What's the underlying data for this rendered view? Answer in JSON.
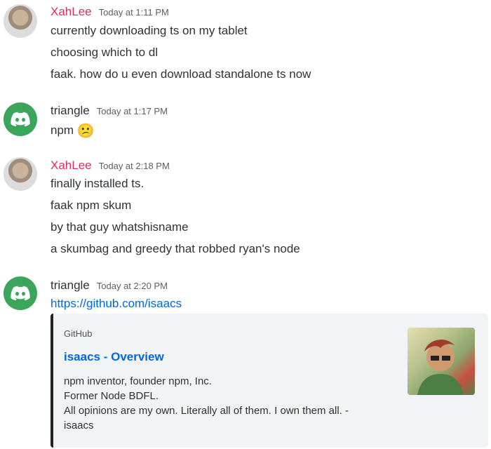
{
  "messages": [
    {
      "username": "XahLee",
      "username_color": "#d92f5a",
      "timestamp": "Today at 1:11 PM",
      "avatar": "user-photo-avatar",
      "lines": [
        "currently downloading ts on my tablet",
        "choosing which to dl",
        "faak. how do u even download standalone ts now"
      ]
    },
    {
      "username": "triangle",
      "username_color": "#2e3338",
      "timestamp": "Today at 1:17 PM",
      "avatar": "discord-logo-avatar",
      "lines": [
        "npm"
      ],
      "emoji": "😕"
    },
    {
      "username": "XahLee",
      "username_color": "#d92f5a",
      "timestamp": "Today at 2:18 PM",
      "avatar": "user-photo-avatar",
      "lines": [
        "finally installed ts.",
        "faak npm skum",
        "by that guy whatshisname",
        "a skumbag and greedy that robbed ryan's node"
      ]
    },
    {
      "username": "triangle",
      "username_color": "#2e3338",
      "timestamp": "Today at 2:20 PM",
      "avatar": "discord-logo-avatar",
      "link": "https://github.com/isaacs",
      "embed": {
        "provider": "GitHub",
        "title": "isaacs - Overview",
        "description": [
          "npm inventor, founder npm, Inc.",
          "Former Node BDFL.",
          "All opinions are my own. Literally all of them. I own them all. -isaacs"
        ],
        "thumbnail": "profile-photo-thumbnail"
      }
    }
  ],
  "colors": {
    "link": "#0068e0",
    "discord_green": "#3ba55c",
    "embed_bg": "#f2f3f5",
    "embed_border": "#202225"
  }
}
